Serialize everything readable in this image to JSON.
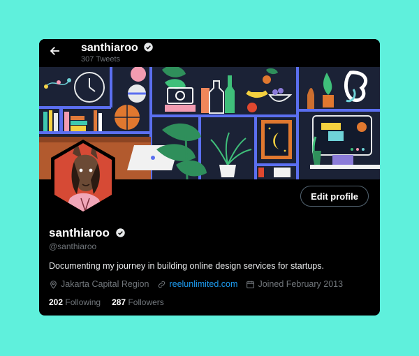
{
  "profile": {
    "display_name": "santhiaroo",
    "tweet_count": "307 Tweets",
    "handle": "@santhiaroo",
    "bio": "Documenting my journey in building online design services for startups.",
    "location": "Jakarta Capital Region",
    "website": "reelunlimited.com",
    "joined": "Joined February 2013",
    "following_count": "202",
    "following_label": "Following",
    "followers_count": "287",
    "followers_label": "Followers",
    "edit_label": "Edit profile"
  },
  "icons": {
    "back": "arrow-left-icon",
    "verified": "verified-badge-icon",
    "location": "location-pin-icon",
    "link": "link-icon",
    "calendar": "calendar-icon"
  },
  "colors": {
    "background": "#5ff0dc",
    "card": "#000000",
    "link": "#1d9bf0",
    "muted": "#71767b",
    "avatar_bg": "#d64a35"
  }
}
